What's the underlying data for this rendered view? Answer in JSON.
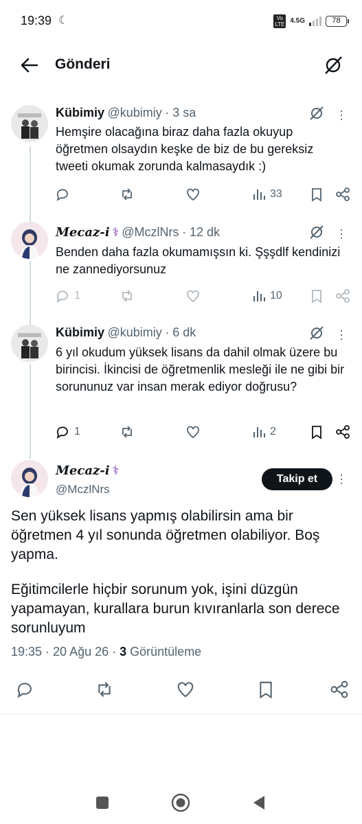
{
  "status_bar": {
    "time": "19:39",
    "network": "4.5G",
    "volte": "Vo\nLTE",
    "battery": "78"
  },
  "header": {
    "title": "Gönderi"
  },
  "replies": [
    {
      "name": "Kübimiy",
      "handle": "@kubimiy",
      "time": "· 3 sa",
      "text": "Hemşire olacağına biraz daha fazla okuyup öğretmen olsaydın keşke de biz de bu gereksiz tweeti okumak zorunda kalmasaydık :)",
      "replies_count": "",
      "views": "33"
    },
    {
      "name": "Mecaz-i",
      "handle": "@MczlNrs",
      "time": "· 12 dk",
      "text": "Benden daha fazla okumamışsın ki. Şşşdlf kendinizi ne zannediyorsunuz",
      "replies_count": "1",
      "views": "10"
    },
    {
      "name": "Kübimiy",
      "handle": "@kubimiy",
      "time": "· 6 dk",
      "text": "6 yıl okudum yüksek lisans da dahil olmak üzere bu birincisi. İkincisi de öğretmenlik mesleği ile ne gibi bir sorununuz var insan merak ediyor doğrusu?",
      "replies_count": "1",
      "views": "2"
    }
  ],
  "main_post": {
    "name": "Mecaz-i",
    "handle": "@MczlNrs",
    "follow_label": "Takip et",
    "paragraph1": "Sen yüksek lisans yapmış olabilirsin ama bir öğretmen 4 yıl sonunda öğretmen olabiliyor. Boş yapma.",
    "paragraph2": "Eğitimcilerle hiçbir sorunum yok, işini düzgün yapamayan, kurallara burun kıvıranlarla son derece sorunluyum",
    "timestamp": "19:35 · 20 Ağu 26 · ",
    "view_count": "3",
    "view_label": " Görüntüleme"
  },
  "colors": {
    "accent_dark": "#0f1419",
    "secondary": "#536471",
    "badge_purple": "#7b3fb0"
  }
}
